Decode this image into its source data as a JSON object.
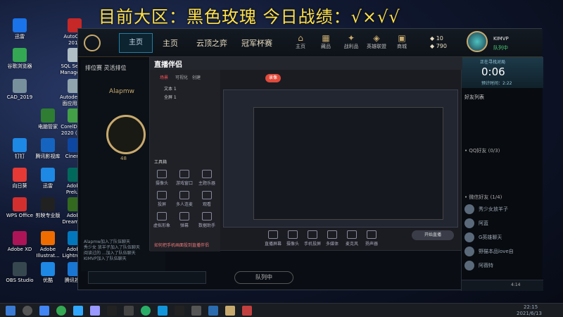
{
  "overlay_title": "目前大区：黑色玫瑰  今日战绩：√×√√",
  "desktop_icons": [
    {
      "label": "迅雷",
      "color": "#1a73e8"
    },
    {
      "label": "AutoCAD 2019",
      "color": "#c62828"
    },
    {
      "label": "谷歌浏览器",
      "color": "#34a853"
    },
    {
      "label": "SQL Server Managem...",
      "color": "#b0bec5"
    },
    {
      "label": "CAD_2019",
      "color": "#78909c"
    },
    {
      "label": "Autodesk 桌面应用程序",
      "color": "#90a4ae"
    },
    {
      "label": "电脑管家",
      "color": "#2e7d32"
    },
    {
      "label": "CorelDRAW 2020 (64...",
      "color": "#43a047"
    },
    {
      "label": "钉钉",
      "color": "#1e88e5"
    },
    {
      "label": "腾讯影视库",
      "color": "#1565c0"
    },
    {
      "label": "Cinema",
      "color": "#0d47a1"
    },
    {
      "label": "向日葵",
      "color": "#e53935"
    },
    {
      "label": "迅雷",
      "color": "#1e88e5"
    },
    {
      "label": "Adobe Prelu...",
      "color": "#00695c"
    },
    {
      "label": "WPS Office",
      "color": "#d32f2f"
    },
    {
      "label": "剪映专业版",
      "color": "#212121"
    },
    {
      "label": "Adobe Dreamw...",
      "color": "#33691e"
    },
    {
      "label": "Adobe XD",
      "color": "#ad1457"
    },
    {
      "label": "Adobe Illustrat...",
      "color": "#ef6c00"
    },
    {
      "label": "Adobe Lightroo...",
      "color": "#0277bd"
    },
    {
      "label": "OBS Studio",
      "color": "#37474f"
    },
    {
      "label": "优酷",
      "color": "#1e88e5"
    },
    {
      "label": "腾讯视频",
      "color": "#1976d2"
    }
  ],
  "top_icons": [
    "Adobe Photosh...",
    "Adobe Effects C...",
    "After",
    "12006..."
  ],
  "client": {
    "play_button": "主页",
    "nav": [
      "主页",
      "云顶之弈",
      "冠军杯赛"
    ],
    "nav_icons": [
      "主页",
      "藏品",
      "战利品",
      "英雄联盟",
      "商城",
      "商店"
    ],
    "currency_be": "10",
    "currency_rp": "790",
    "username": "KIMVP",
    "status": "队列中",
    "level": "137"
  },
  "lobby": {
    "mode": "排位赛 灵活排位",
    "player_name": "Alapmw",
    "rank_level": "48",
    "chat_lines": [
      "Alapmw加入了队伍聊天",
      "秀少女 放羊子加入了队伍聊天",
      "阅读过的 ...加入了队伍聊天",
      "KIMVP加入了队伍聊天"
    ],
    "queue_button": "队列中"
  },
  "sidepanel": {
    "header": "正在寻找对局",
    "timer": "0:06",
    "estimate": "预计时间：2:22",
    "friends_label": "好友列表",
    "group_qq": "• QQ好友 (0/3)",
    "group_wechat": "• 微信好友 (1/4)",
    "friends": [
      "秀少女放羊子",
      "阿蓝",
      "G英雄聊天",
      "野猫本品love自",
      "阿薇特"
    ],
    "time_status": "4:14"
  },
  "obs": {
    "title": "直播伴侣",
    "tabs": [
      "场景",
      "可视化",
      "创建"
    ],
    "sources": [
      "文本 1",
      "全屏 1"
    ],
    "toolbar_label": "工具箱",
    "record_label": "录像",
    "live_btn": "开始直播",
    "tools": [
      "摄像头",
      "游戏窗口",
      "主题乐器",
      "投屏",
      "多人连麦",
      "观看",
      "虚拟形象",
      "弹幕",
      "数据助手"
    ],
    "bottom_tools": [
      "直播屏幕",
      "摄像头",
      "手机投屏",
      "多媒体",
      "麦克风",
      "扬声器"
    ],
    "notice": "如何把手机画面投到直播伴侣"
  },
  "taskbar": {
    "time": "22:15",
    "date": "2021/6/13"
  }
}
